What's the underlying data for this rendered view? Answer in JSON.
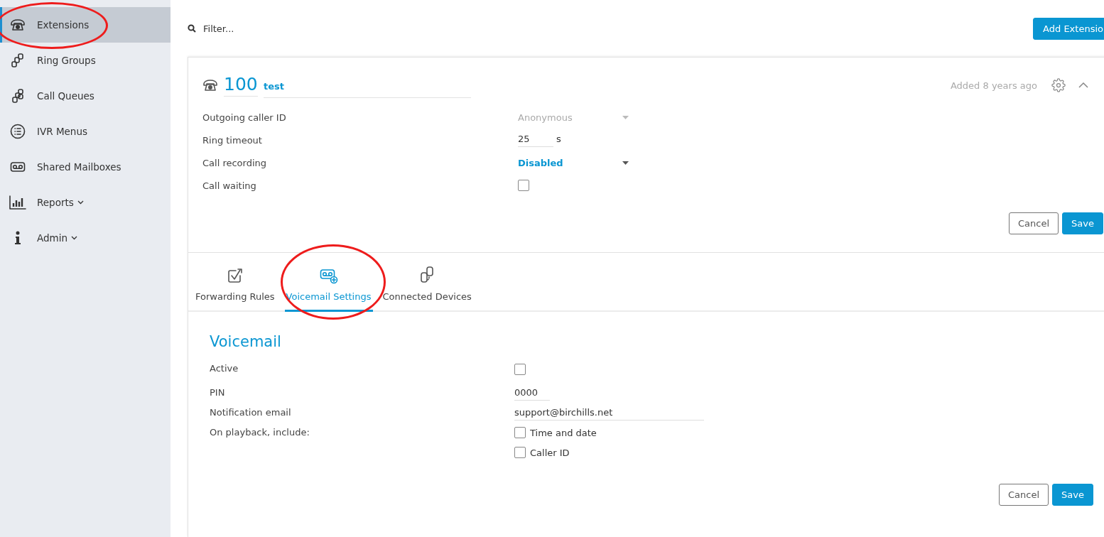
{
  "sidebar": {
    "items": [
      {
        "label": "Extensions",
        "selected": true,
        "circled": true,
        "caret": false
      },
      {
        "label": "Ring Groups",
        "selected": false,
        "circled": false,
        "caret": false
      },
      {
        "label": "Call Queues",
        "selected": false,
        "circled": false,
        "caret": false
      },
      {
        "label": "IVR Menus",
        "selected": false,
        "circled": false,
        "caret": false
      },
      {
        "label": "Shared Mailboxes",
        "selected": false,
        "circled": false,
        "caret": false
      },
      {
        "label": "Reports",
        "selected": false,
        "circled": false,
        "caret": true
      },
      {
        "label": "Admin",
        "selected": false,
        "circled": false,
        "caret": true
      }
    ]
  },
  "toolbar": {
    "filter": {
      "placeholder": "Filter..."
    },
    "add_button": "Add Extensio"
  },
  "extension": {
    "number": "100",
    "name": "test",
    "added": "Added 8 years ago",
    "expanded": true,
    "fields": [
      {
        "kind": "select",
        "label": "Outgoing caller ID",
        "value": "Anonymous",
        "disabled": true
      },
      {
        "kind": "number",
        "label": "Ring timeout",
        "value": "25",
        "unit": "s"
      },
      {
        "kind": "select",
        "label": "Call recording",
        "value": "Disabled",
        "disabled": false
      },
      {
        "kind": "checkbox",
        "label": "Call waiting",
        "checked": false
      }
    ],
    "buttons": {
      "cancel": "Cancel",
      "save": "Save"
    }
  },
  "tabs": [
    {
      "label": "Forwarding Rules",
      "selected": false,
      "circled": false
    },
    {
      "label": "Voicemail Settings",
      "selected": true,
      "circled": true
    },
    {
      "label": "Connected Devices",
      "selected": false,
      "circled": false
    }
  ],
  "voicemail": {
    "title": "Voicemail",
    "fields": [
      {
        "kind": "checkbox",
        "label": "Active",
        "checked": false
      },
      {
        "kind": "text",
        "label": "PIN",
        "value": "0000",
        "wide": false
      },
      {
        "kind": "text",
        "label": "Notification email",
        "value": "support@birchills.net",
        "wide": true
      },
      {
        "kind": "options",
        "label": "On playback, include:",
        "options": [
          {
            "label": "Time and date",
            "checked": false
          },
          {
            "label": "Caller ID",
            "checked": false
          }
        ]
      }
    ],
    "buttons": {
      "cancel": "Cancel",
      "save": "Save"
    }
  }
}
